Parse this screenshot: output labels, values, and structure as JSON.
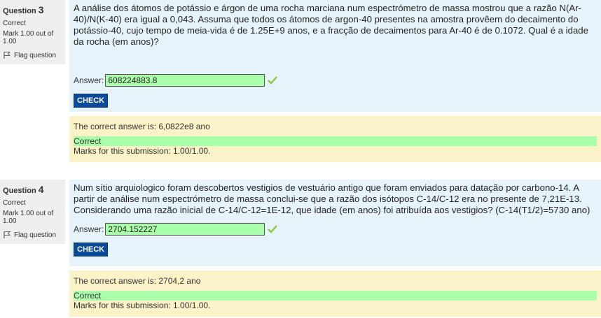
{
  "questions": [
    {
      "label": "Question",
      "number": "3",
      "state": "Correct",
      "grade": "Mark 1.00 out of 1.00",
      "flag_label": "Flag question",
      "text": "A análise dos átomos de potássio e árgon de uma rocha marciana num espectrómetro de massa mostrou que a razão N(Ar-40)/N(K-40) era igual a 0,043. Assuma que todos os átomos de argon-40 presentes na amostra provêem do decaimento do potássio-40, cujo tempo de meia-vida é de 1.25E+9 anos, e a fracção de decaimentos para Ar-40 é de 0.1072. Qual é a idade da rocha (em anos)?",
      "answer_label": "Answer:",
      "answer_value": "608224883.8",
      "check_label": "CHECK",
      "right_answer": "The correct answer is: 6,0822e8 ano",
      "feedback_state": "Correct",
      "marks": "Marks for this submission: 1.00/1.00."
    },
    {
      "label": "Question",
      "number": "4",
      "state": "Correct",
      "grade": "Mark 1.00 out of 1.00",
      "flag_label": "Flag question",
      "text": "Num sítio arquiologico foram descobertos vestigios de vestuário antigo que foram enviados para datação por carbono-14. A partir de análise num espectrómetro de massa conclui-se que a razão dos isótopos C-14/C-12 era no presente de 7,21E-13. Considerando uma razão inicial de C-14/C-12=1E-12, que idade (em anos) foi atribuída aos vestigios? (C-14(T1/2)=5730 ano)",
      "answer_label": "Answer:",
      "answer_value": "2704.152227",
      "check_label": "CHECK",
      "right_answer": "The correct answer is: 2704,2 ano",
      "feedback_state": "Correct",
      "marks": "Marks for this submission: 1.00/1.00."
    }
  ],
  "colors": {
    "formulation_bg": "#e7f3fb",
    "outcome_bg": "#fcf2c7",
    "correct_green": "#aaffaa",
    "check_button": "#0a4a96",
    "tick": "#8cc63f"
  },
  "icons": {
    "flag": "flag-icon",
    "tick": "checkmark-icon"
  }
}
